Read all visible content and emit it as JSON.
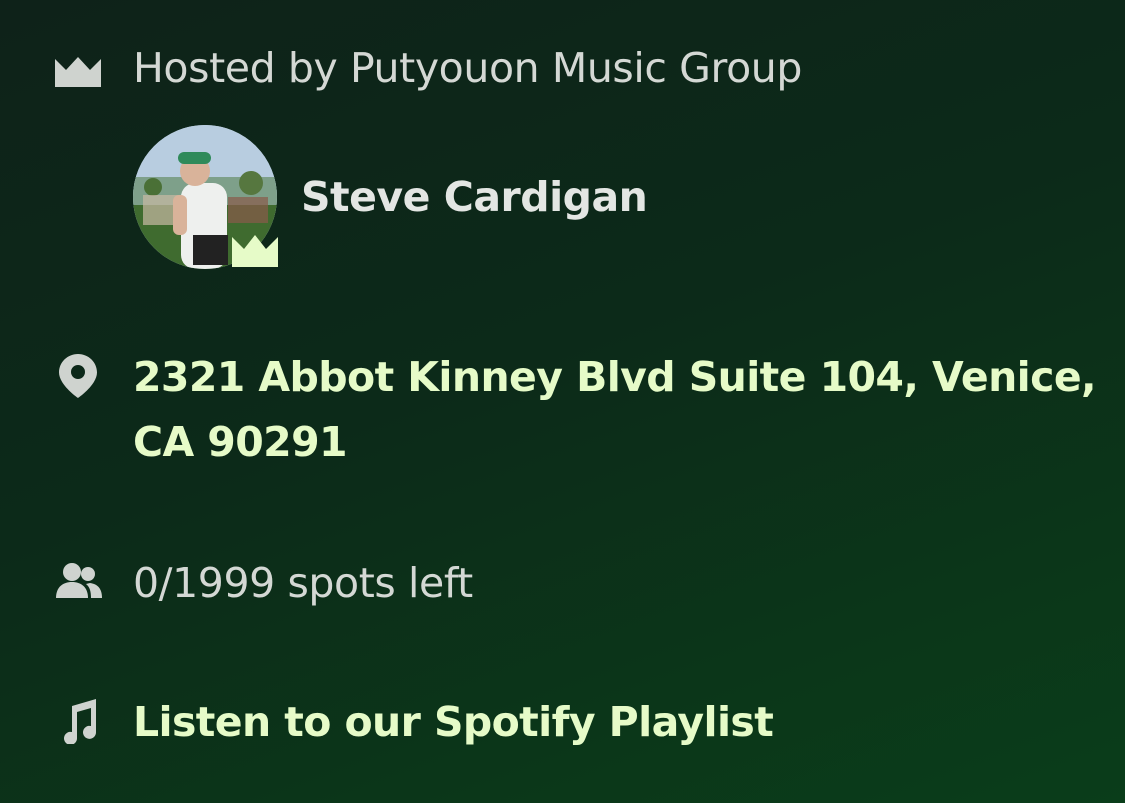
{
  "host": {
    "label": "Hosted by Putyouon Music Group",
    "name": "Steve Cardigan"
  },
  "location": {
    "line1": "2321 Abbot Kinney Blvd Suite 104, Venice,",
    "line2": "CA 90291"
  },
  "capacity": {
    "text": "0/1999 spots left"
  },
  "playlist": {
    "link_text": "Listen to our Spotify Playlist"
  },
  "icons": {
    "host": "crown-icon",
    "badge": "crown-badge-icon",
    "location": "map-pin-icon",
    "capacity": "users-icon",
    "playlist": "music-note-icon"
  },
  "colors": {
    "accent": "#e6fbc8",
    "muted_text": "#d4d8d4",
    "icon": "#cfd3cf",
    "background": "#0c2a19"
  }
}
